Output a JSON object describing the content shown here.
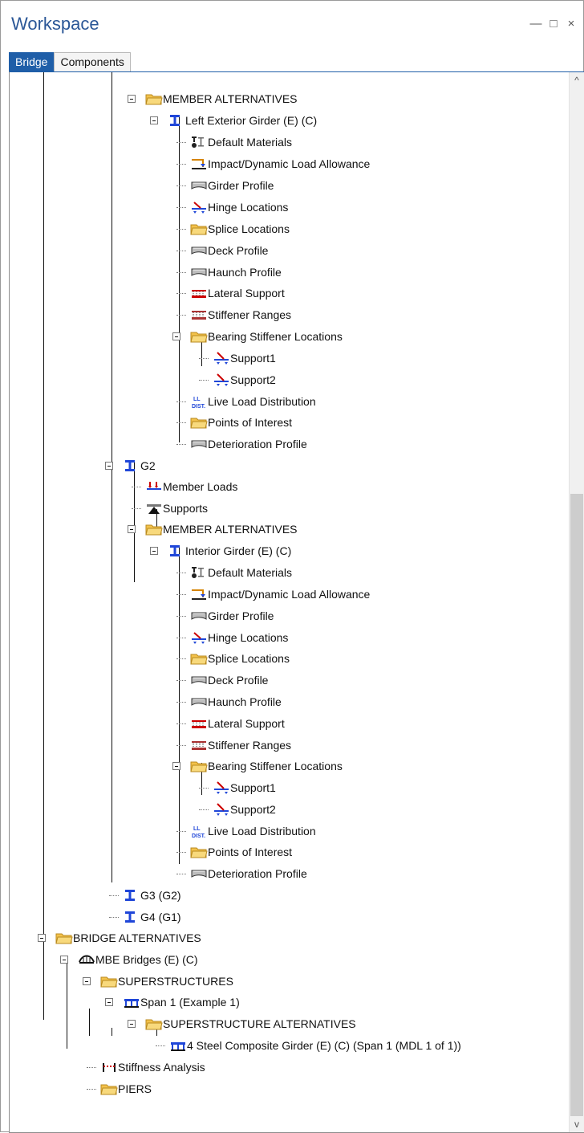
{
  "window": {
    "title": "Workspace",
    "controls": {
      "minimize": "—",
      "maximize": "□",
      "close": "×"
    }
  },
  "tabs": [
    {
      "label": "Bridge",
      "active": true
    },
    {
      "label": "Components",
      "active": false
    }
  ],
  "tree": [
    {
      "label": "MEMBER ALTERNATIVES",
      "icon": "folder-icon",
      "expanded": true
    },
    {
      "label": "Left Exterior Girder (E)  (C)",
      "icon": "i-beam-icon",
      "expanded": true
    },
    {
      "label": "Default Materials",
      "icon": "materials-icon"
    },
    {
      "label": "Impact/Dynamic Load Allowance",
      "icon": "impact-load-icon"
    },
    {
      "label": "Girder Profile",
      "icon": "profile-icon"
    },
    {
      "label": "Hinge Locations",
      "icon": "hinge-icon"
    },
    {
      "label": "Splice Locations",
      "icon": "folder-icon"
    },
    {
      "label": "Deck Profile",
      "icon": "profile-icon"
    },
    {
      "label": "Haunch Profile",
      "icon": "profile-icon"
    },
    {
      "label": "Lateral Support",
      "icon": "lateral-support-icon"
    },
    {
      "label": "Stiffener Ranges",
      "icon": "stiffener-icon"
    },
    {
      "label": "Bearing Stiffener Locations",
      "icon": "folder-icon",
      "expanded": true
    },
    {
      "label": "Support1",
      "icon": "support-location-icon"
    },
    {
      "label": "Support2",
      "icon": "support-location-icon"
    },
    {
      "label": "Live Load Distribution",
      "icon": "live-load-distribution-icon"
    },
    {
      "label": "Points of Interest",
      "icon": "folder-icon"
    },
    {
      "label": "Deterioration Profile",
      "icon": "profile-icon"
    },
    {
      "label": "G2",
      "icon": "i-beam-icon",
      "expanded": true
    },
    {
      "label": "Member Loads",
      "icon": "member-loads-icon"
    },
    {
      "label": "Supports",
      "icon": "supports-icon"
    },
    {
      "label": "MEMBER ALTERNATIVES",
      "icon": "folder-icon",
      "expanded": true
    },
    {
      "label": "Interior Girder (E)  (C)",
      "icon": "i-beam-icon",
      "expanded": true
    },
    {
      "label": "Default Materials",
      "icon": "materials-icon"
    },
    {
      "label": "Impact/Dynamic Load Allowance",
      "icon": "impact-load-icon"
    },
    {
      "label": "Girder Profile",
      "icon": "profile-icon"
    },
    {
      "label": "Hinge Locations",
      "icon": "hinge-icon"
    },
    {
      "label": "Splice Locations",
      "icon": "folder-icon"
    },
    {
      "label": "Deck Profile",
      "icon": "profile-icon"
    },
    {
      "label": "Haunch Profile",
      "icon": "profile-icon"
    },
    {
      "label": "Lateral Support",
      "icon": "lateral-support-icon"
    },
    {
      "label": "Stiffener Ranges",
      "icon": "stiffener-icon"
    },
    {
      "label": "Bearing Stiffener Locations",
      "icon": "folder-icon",
      "expanded": true
    },
    {
      "label": "Support1",
      "icon": "support-location-icon"
    },
    {
      "label": "Support2",
      "icon": "support-location-icon"
    },
    {
      "label": "Live Load Distribution",
      "icon": "live-load-distribution-icon"
    },
    {
      "label": "Points of Interest",
      "icon": "folder-icon"
    },
    {
      "label": "Deterioration Profile",
      "icon": "profile-icon"
    },
    {
      "label": "G3 (G2)",
      "icon": "i-beam-icon"
    },
    {
      "label": "G4 (G1)",
      "icon": "i-beam-icon"
    },
    {
      "label": "BRIDGE ALTERNATIVES",
      "icon": "folder-icon",
      "expanded": true
    },
    {
      "label": "MBE Bridges (E)  (C)",
      "icon": "bridge-icon",
      "expanded": true
    },
    {
      "label": "SUPERSTRUCTURES",
      "icon": "folder-icon",
      "expanded": true
    },
    {
      "label": "Span 1 (Example 1)",
      "icon": "superstructure-icon",
      "expanded": true
    },
    {
      "label": "SUPERSTRUCTURE ALTERNATIVES",
      "icon": "folder-icon",
      "expanded": true
    },
    {
      "label": "4 Steel Composite Girder (E)  (C) (Span 1 (MDL 1 of 1))",
      "icon": "superstructure-icon"
    },
    {
      "label": "Stiffness Analysis",
      "icon": "stiffness-analysis-icon"
    },
    {
      "label": "PIERS",
      "icon": "folder-icon"
    }
  ],
  "scrollbar": {
    "up": "^",
    "down": "v"
  }
}
